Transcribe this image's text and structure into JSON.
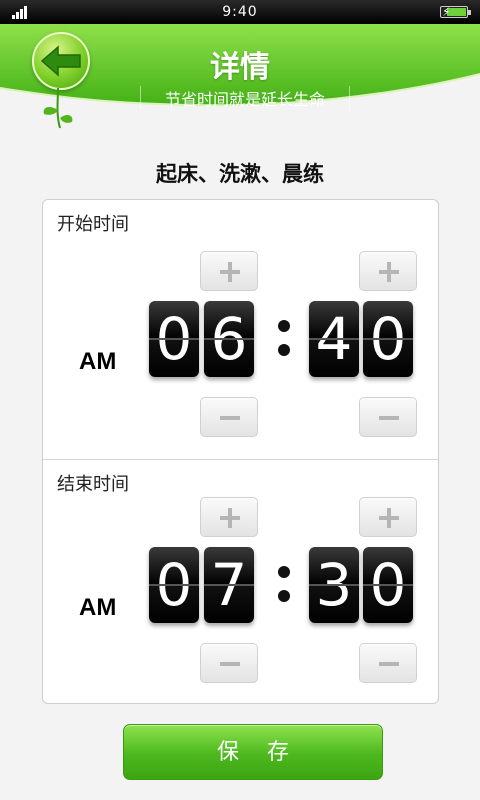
{
  "status_bar": {
    "time": "9:40"
  },
  "header": {
    "title": "详情",
    "subtitle": "节省时间就是延长生命"
  },
  "task": {
    "title": "起床、洗漱、晨练"
  },
  "start": {
    "label": "开始时间",
    "ampm": "AM",
    "h1": "0",
    "h2": "6",
    "m1": "4",
    "m2": "0"
  },
  "end": {
    "label": "结束时间",
    "ampm": "AM",
    "h1": "0",
    "h2": "7",
    "m1": "3",
    "m2": "0"
  },
  "save_label": "保存",
  "colors": {
    "green": "#5cc527",
    "dark": "#000000"
  }
}
